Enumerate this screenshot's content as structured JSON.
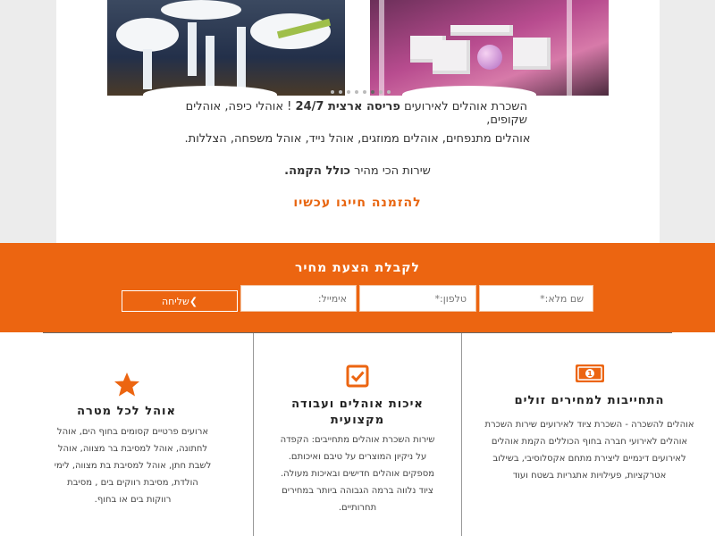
{
  "gallery": {
    "dots_count": 8,
    "active_dot": 5
  },
  "intro": {
    "line1_prefix": "השכרת אוהלים לאירועים",
    "line1_bold": "פריסה ארצית 24/7",
    "line1_suffix": "! אוהלי כיפה, אוהלים שקופים,",
    "line2": "אוהלים מתנפחים, אוהלים ממוזגים, אוהל נייד, אוהל משפחה, הצללות.",
    "line3_prefix": "שירות הכי מהיר",
    "line3_bold": "כולל הקמה.",
    "cta": "להזמנה חייגו עכשיו"
  },
  "quote_form": {
    "title": "לקבלת הצעת מחיר",
    "name_placeholder": "שם מלא:*",
    "phone_placeholder": "טלפון:*",
    "email_placeholder": "אימייל:",
    "send_label": "שליחה"
  },
  "features": [
    {
      "icon": "money-icon",
      "title": "התחייבות למחירים זולים",
      "text": "אוהלים להשכרה - השכרת ציוד לאירועים שירות השכרת אוהלים לאירועי חברה בחוף הכוללים הקמת אוהלים לאירועים דינמיים ליצירת מתחם אקסלוסיבי, בשילוב אטרקציות, פעילויות אתגריות בשטח ועוד"
    },
    {
      "icon": "checkbox-icon",
      "title": "איכות אוהלים ועבודה מקצועית",
      "text": "שירות השכרת אוהלים מתחייבים: הקפדה על ניקיון המוצרים על טיבם ואיכותם. מספקים אוהלים חדישים ובאיכות מעולה. ציוד נלווה ברמה הגבוהה ביותר במחירים תחרותיים."
    },
    {
      "icon": "star-icon",
      "title": "אוהל לכל מטרה",
      "text": "ארועים פרטיים קסומים בחוף הים, אוהל לחתונה, אוהל למסיבת בר מצווה, אוהל לשבת חתן, אוהל למסיבת בת מצווה, לימי הולדת, מסיבת רווקים בים , מסיבת רווקות בים או בחוף."
    }
  ],
  "colors": {
    "accent": "#ec6511",
    "text": "#333333"
  }
}
